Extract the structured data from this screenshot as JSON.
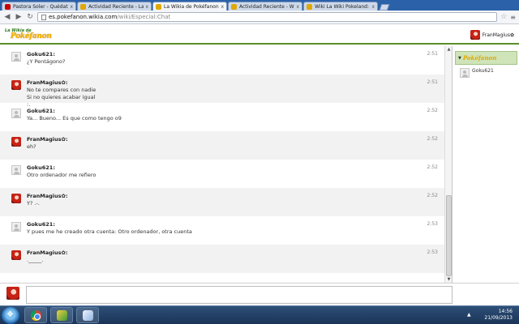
{
  "browser": {
    "tabs": [
      {
        "label": "Pastora Soler - Quédate C...",
        "favicon_color": "#cc0000",
        "active": false
      },
      {
        "label": "Actividad Reciente - La Wi...",
        "favicon_color": "#e0a800",
        "active": false
      },
      {
        "label": "La Wikia de Pokéfanon: B...",
        "favicon_color": "#e0a800",
        "active": true
      },
      {
        "label": "Actividad Reciente - Wiki...",
        "favicon_color": "#e0a800",
        "active": false
      },
      {
        "label": "Wiki La Wiki Pokeland: B...",
        "favicon_color": "#e0a800",
        "active": false
      }
    ],
    "close_glyph": "x",
    "address": {
      "host": "es.pokefanon.wikia.com",
      "path": "/wiki/Especial:Chat"
    }
  },
  "header": {
    "logo_top": "La Wikia de",
    "logo_main": "Pokéfanon",
    "current_user": "FranMagius✿"
  },
  "messages": [
    {
      "user": "Goku621:",
      "time": "2:51",
      "lines": [
        "¿Y Pentágono?"
      ],
      "avatar": "grey"
    },
    {
      "user": "FranMagius✿:",
      "time": "2:51",
      "lines": [
        "No te compares con nadie",
        "Si no quieres acabar igual",
        ":."
      ],
      "avatar": "red"
    },
    {
      "user": "Goku621:",
      "time": "2:52",
      "lines": [
        "Ya... Bueno... Es que como tengo o9"
      ],
      "avatar": "grey"
    },
    {
      "user": "FranMagius✿:",
      "time": "2:52",
      "lines": [
        "eh?"
      ],
      "avatar": "red"
    },
    {
      "user": "Goku621:",
      "time": "2:52",
      "lines": [
        "Otro ordenador me refiero"
      ],
      "avatar": "grey"
    },
    {
      "user": "FranMagius✿:",
      "time": "2:52",
      "lines": [
        "Y? .-."
      ],
      "avatar": "red"
    },
    {
      "user": "Goku621:",
      "time": "2:53",
      "lines": [
        "Y pues me he creado otra cuenta: Otro ordenador, otra cuenta"
      ],
      "avatar": "grey"
    },
    {
      "user": "FranMagius✿:",
      "time": "2:53",
      "lines": [
        "._____."
      ],
      "avatar": "red"
    }
  ],
  "sidebar": {
    "wiki_label": "Pokéfanon",
    "users": [
      "Goku621"
    ]
  },
  "taskbar": {
    "time": "14:56",
    "date": "21/09/2013"
  }
}
